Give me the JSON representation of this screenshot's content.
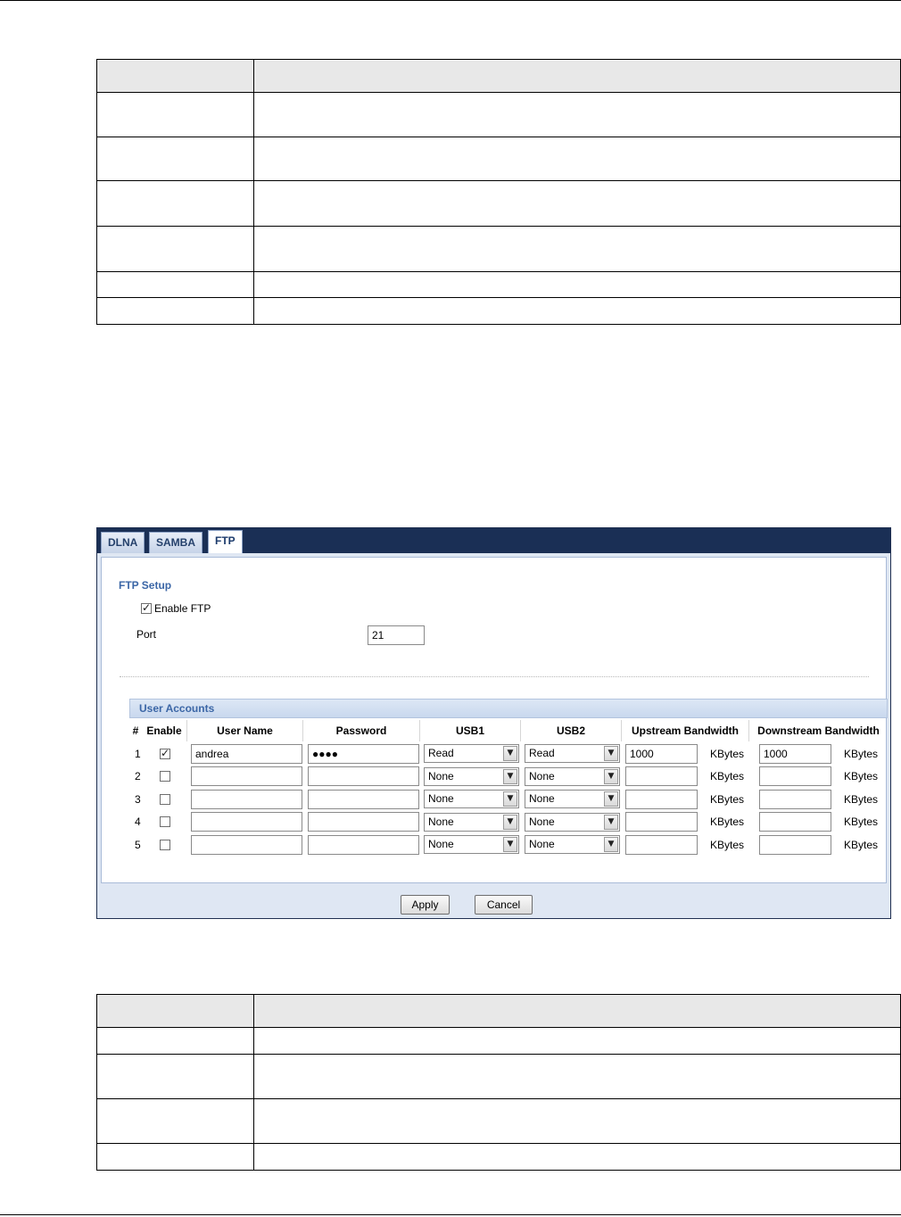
{
  "ftp_ui": {
    "tabs": [
      {
        "label": "DLNA",
        "active": false
      },
      {
        "label": "SAMBA",
        "active": false
      },
      {
        "label": "FTP",
        "active": true
      }
    ],
    "section_title": "FTP Setup",
    "enable_ftp": {
      "label": "Enable FTP",
      "checked": true
    },
    "port": {
      "label": "Port",
      "value": "21"
    },
    "accounts": {
      "title": "User Accounts",
      "columns": [
        "#",
        "Enable",
        "User Name",
        "Password",
        "USB1",
        "USB2",
        "Upstream Bandwidth",
        "Downstream Bandwidth"
      ],
      "unit": "KBytes",
      "rows": [
        {
          "num": "1",
          "enabled": true,
          "user": "andrea",
          "password": "●●●●",
          "usb1": "Read",
          "usb2": "Read",
          "up": "1000",
          "down": "1000"
        },
        {
          "num": "2",
          "enabled": false,
          "user": "",
          "password": "",
          "usb1": "None",
          "usb2": "None",
          "up": "",
          "down": ""
        },
        {
          "num": "3",
          "enabled": false,
          "user": "",
          "password": "",
          "usb1": "None",
          "usb2": "None",
          "up": "",
          "down": ""
        },
        {
          "num": "4",
          "enabled": false,
          "user": "",
          "password": "",
          "usb1": "None",
          "usb2": "None",
          "up": "",
          "down": ""
        },
        {
          "num": "5",
          "enabled": false,
          "user": "",
          "password": "",
          "usb1": "None",
          "usb2": "None",
          "up": "",
          "down": ""
        }
      ]
    },
    "buttons": {
      "apply": "Apply",
      "cancel": "Cancel"
    }
  }
}
